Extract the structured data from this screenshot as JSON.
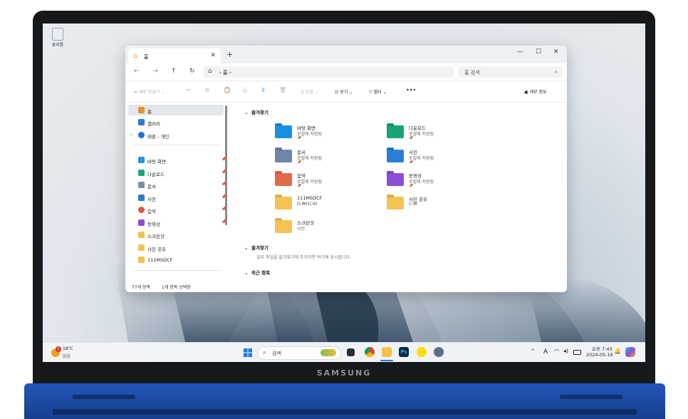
{
  "laptop": {
    "brand": "SAMSUNG"
  },
  "desktop": {
    "recycle_bin_label": "휴지통"
  },
  "window": {
    "tab_title": "홈",
    "tab_close": "✕",
    "new_tab": "+",
    "controls": {
      "minimize": "—",
      "maximize": "☐",
      "close": "✕"
    },
    "nav": {
      "back": "←",
      "forward": "→",
      "up": "↑",
      "refresh": "↻"
    },
    "address": {
      "home_glyph": "⌂",
      "path": "›  홈  ›"
    },
    "search_placeholder": "홈 검색",
    "toolbar": {
      "new": "⊕  새로 만들기  ⌄",
      "cut": "✂",
      "copy": "⧉",
      "paste": "📋",
      "rename": "Ⓐ",
      "share": "⇪",
      "delete": "🗑",
      "sort": "⇅  정렬  ⌄",
      "view": "☷  보기  ⌄",
      "filter": "▽  필터  ⌄",
      "more": "•••",
      "details": "▣  세부 정보"
    },
    "sidebar": {
      "top": [
        {
          "label": "홈",
          "color": "#e8912d"
        },
        {
          "label": "갤러리",
          "color": "#2b7bd6"
        },
        {
          "label": "태훈 - 개인",
          "color": "#1f6fe0"
        }
      ],
      "pinned": [
        {
          "label": "바탕 화면",
          "color": "#2f8fe0"
        },
        {
          "label": "다운로드",
          "color": "#19a974"
        },
        {
          "label": "문서",
          "color": "#7a8ea8"
        },
        {
          "label": "사진",
          "color": "#2b7bd6"
        },
        {
          "label": "음악",
          "color": "#e0573b"
        },
        {
          "label": "동영상",
          "color": "#8a4fd8"
        }
      ],
      "folders": [
        {
          "label": "스크린샷",
          "color": "#f2c24b"
        },
        {
          "label": "사진 공유",
          "color": "#f2c24b"
        },
        {
          "label": "111MSDCF",
          "color": "#f2c24b"
        }
      ],
      "pin_glyph": "📌"
    },
    "status": {
      "items": "77개 항목",
      "selected": "1개 항목 선택함"
    },
    "quick_access": {
      "heading": "즐겨찾기",
      "items": [
        {
          "name": "바탕 화면",
          "sub": "로컬에 저장됨",
          "pin": "📌",
          "color": "#1d8fe0"
        },
        {
          "name": "다운로드",
          "sub": "로컬에 저장됨",
          "pin": "📌",
          "color": "#1aa37a"
        },
        {
          "name": "문서",
          "sub": "로컬에 저장됨",
          "pin": "📌",
          "color": "#6f86a6"
        },
        {
          "name": "사진",
          "sub": "로컬에 저장됨",
          "pin": "📌",
          "color": "#2a80d8"
        },
        {
          "name": "음악",
          "sub": "로컬에 저장됨",
          "pin": "📌",
          "color": "#e06a4b"
        },
        {
          "name": "동영상",
          "sub": "로컬에 저장됨",
          "pin": "📌",
          "color": "#8a4fd8"
        },
        {
          "name": "111MSDCF",
          "sub": "D:₩DCIM",
          "pin": "",
          "color": "#f4c452"
        },
        {
          "name": "사진 공유",
          "sub": "E:₩",
          "pin": "",
          "color": "#f4c452"
        },
        {
          "name": "스크린샷",
          "sub": "사진",
          "pin": "",
          "color": "#f4c452"
        }
      ]
    },
    "favorites": {
      "heading": "즐겨찾기",
      "hint": "일부 파일을 즐겨찾기에 추가하면 여기에 표시됩니다."
    },
    "recent": {
      "heading": "최근 항목"
    }
  },
  "taskbar": {
    "weather_temp": "18°C",
    "weather_desc": "맑음",
    "weather_badge": "1",
    "search_label": "검색",
    "ps_label": "Ps",
    "tray_chevron": "^",
    "ime": "A",
    "time": "오후 7:43",
    "date": "2024-05-16"
  }
}
